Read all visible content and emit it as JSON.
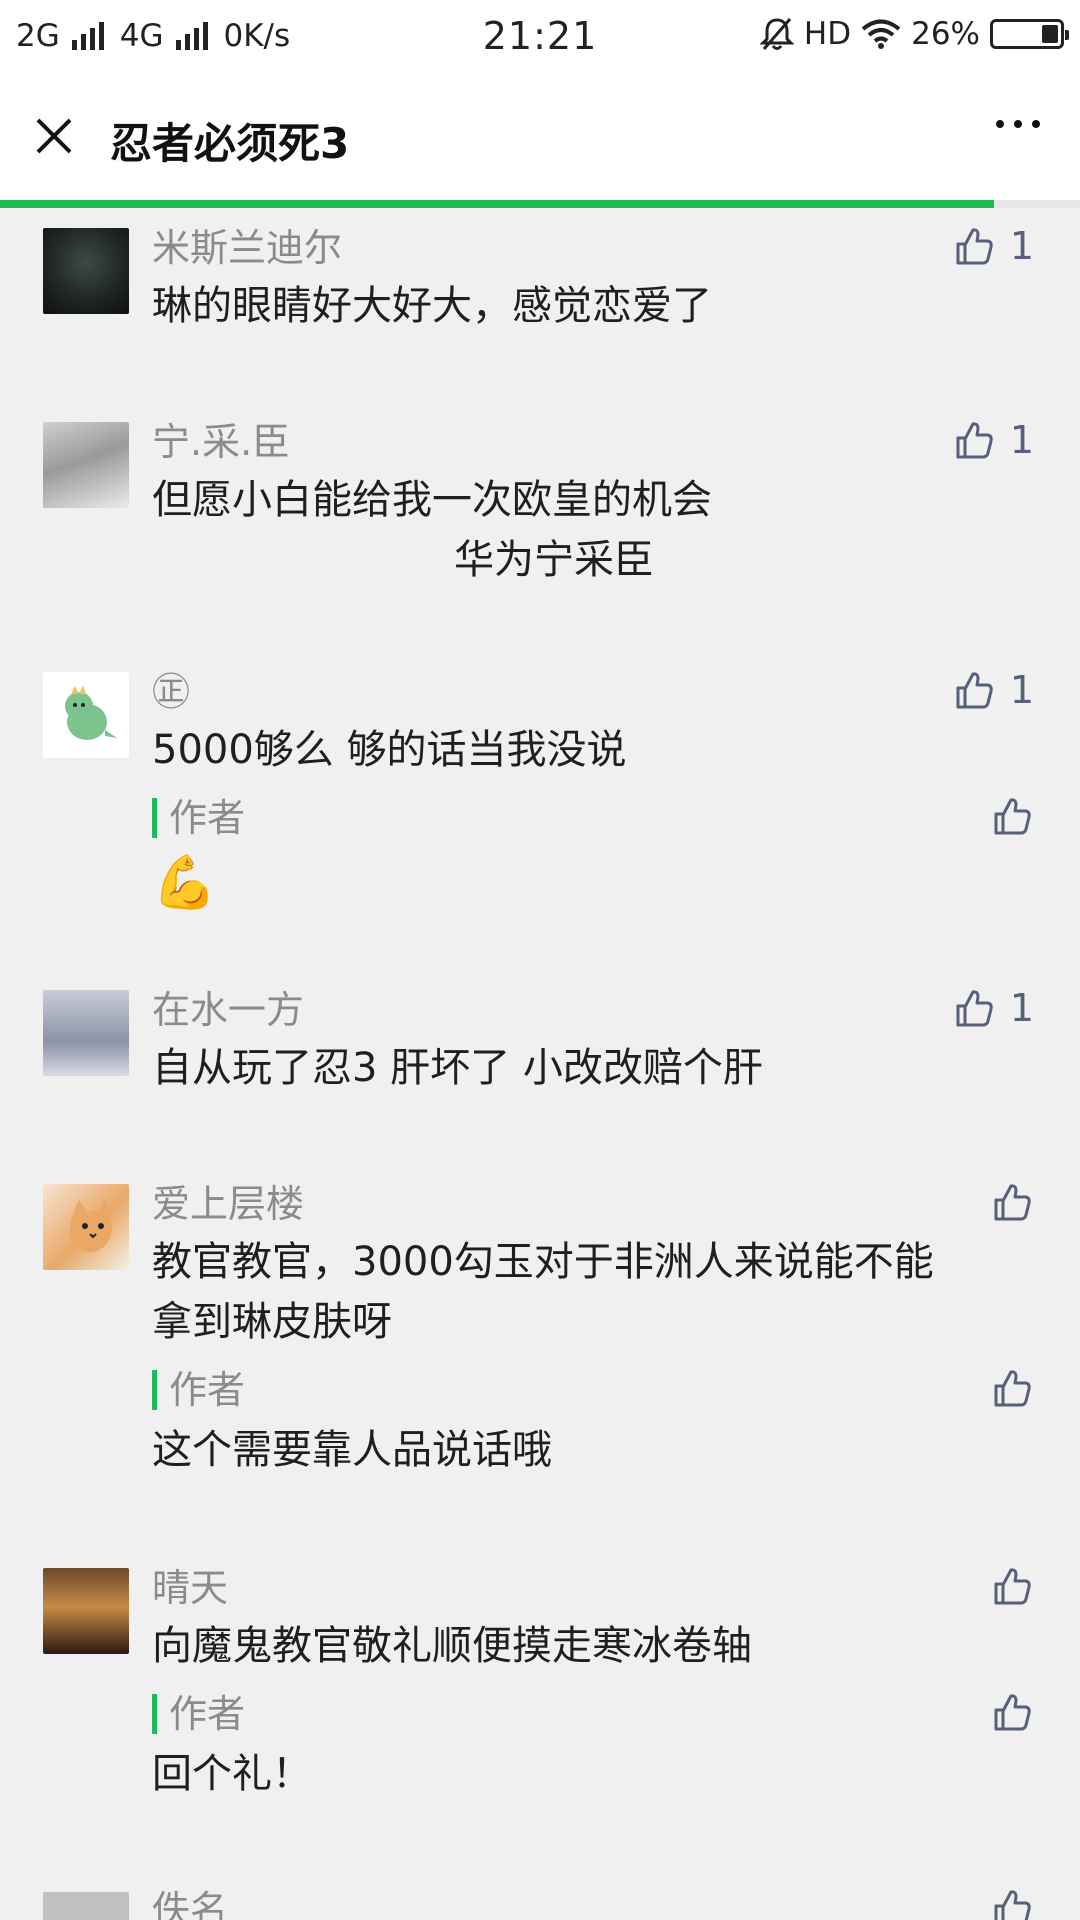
{
  "status_bar": {
    "net1": "2G",
    "net2": "4G",
    "speed": "0K/s",
    "time": "21:21",
    "hd": "HD",
    "battery": "26%",
    "battery_level": 0.26
  },
  "header": {
    "title": "忍者必须死3",
    "load_progress": 0.92
  },
  "comments": [
    {
      "nick": "米斯兰迪尔",
      "lines": [
        "琳的眼睛好大好大，感觉恋爱了"
      ],
      "likes": "1"
    },
    {
      "nick": "宁.采.臣",
      "lines": [
        "但愿小白能给我一次欧皇的机会",
        "华为宁采臣"
      ],
      "likes": "1"
    },
    {
      "nick": "㊣",
      "lines": [
        "5000够么  够的话当我没说"
      ],
      "likes": "1",
      "reply": {
        "tag": "作者",
        "text": "💪"
      }
    },
    {
      "nick": "在水一方",
      "lines": [
        "自从玩了忍3 肝坏了 小改改赔个肝"
      ],
      "likes": "1"
    },
    {
      "nick": "爱上层楼",
      "lines": [
        "教官教官，3000勾玉对于非洲人来说能不能",
        "拿到琳皮肤呀"
      ],
      "likes": "",
      "reply": {
        "tag": "作者",
        "text": "这个需要靠人品说话哦"
      }
    },
    {
      "nick": "晴天",
      "lines": [
        "向魔鬼教官敬礼顺便摸走寒冰卷轴"
      ],
      "likes": "",
      "reply": {
        "tag": "作者",
        "text": "回个礼！"
      }
    },
    {
      "nick": "佚名",
      "lines": [],
      "likes": ""
    }
  ]
}
